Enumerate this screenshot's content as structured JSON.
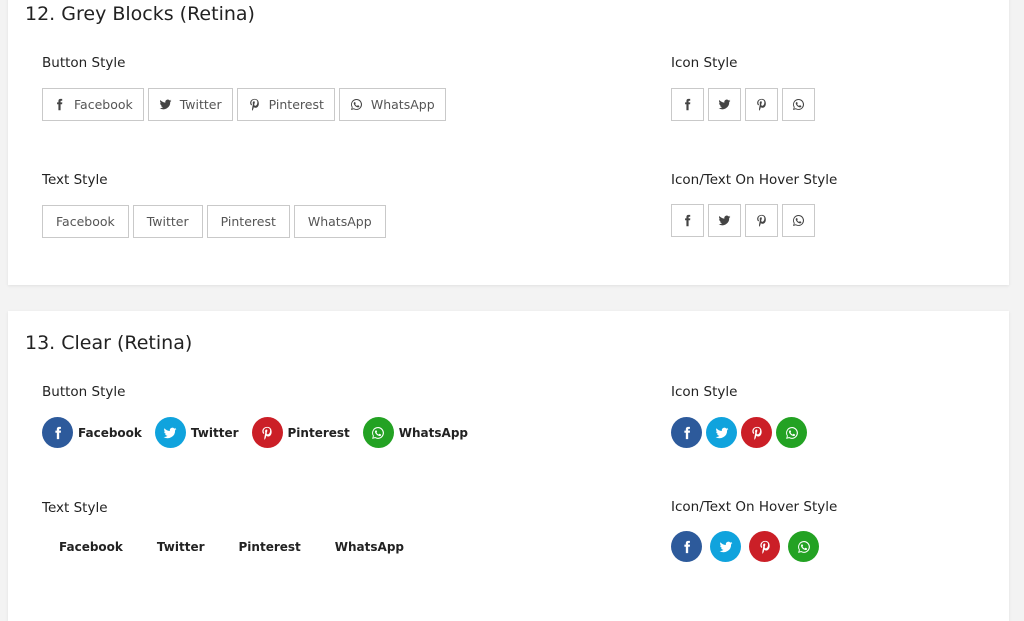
{
  "colors": {
    "facebook": "#2d5a9b",
    "twitter": "#10a3dd",
    "pinterest": "#cb1f27",
    "whatsapp": "#23a223"
  },
  "section12": {
    "title": "12. Grey Blocks (Retina)",
    "button_style_label": "Button Style",
    "icon_style_label": "Icon Style",
    "text_style_label": "Text Style",
    "hover_style_label": "Icon/Text On Hover Style",
    "buttons": [
      "Facebook",
      "Twitter",
      "Pinterest",
      "WhatsApp"
    ],
    "texts": [
      "Facebook",
      "Twitter",
      "Pinterest",
      "WhatsApp"
    ]
  },
  "section13": {
    "title": "13. Clear (Retina)",
    "button_style_label": "Button Style",
    "icon_style_label": "Icon Style",
    "text_style_label": "Text Style",
    "hover_style_label": "Icon/Text On Hover Style",
    "buttons": [
      "Facebook",
      "Twitter",
      "Pinterest",
      "WhatsApp"
    ],
    "texts": [
      "Facebook",
      "Twitter",
      "Pinterest",
      "WhatsApp"
    ]
  },
  "icons": [
    "facebook-icon",
    "twitter-icon",
    "pinterest-icon",
    "whatsapp-icon"
  ]
}
